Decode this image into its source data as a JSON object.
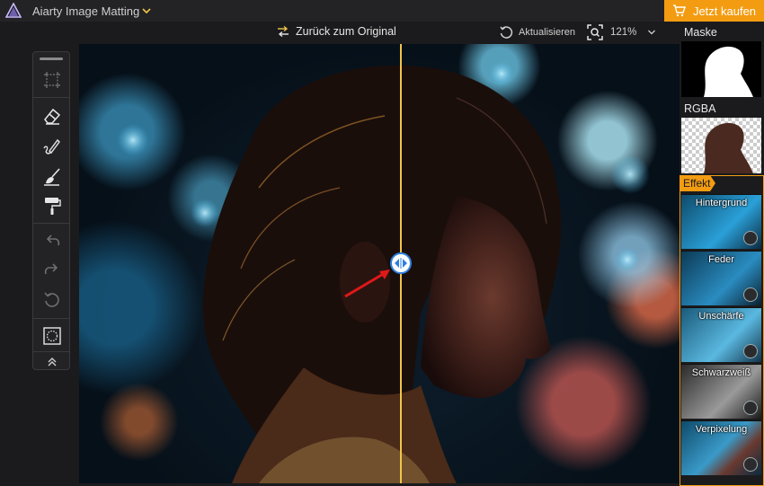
{
  "app": {
    "title": "Aiarty Image Matting",
    "buy_label": "Jetzt kaufen",
    "accent": "#f39c12"
  },
  "toolbar": {
    "back_label": "Zurück zum Original",
    "refresh_label": "Aktualisieren",
    "zoom_label": "121%"
  },
  "tools": [
    {
      "name": "select-region-icon"
    },
    {
      "name": "eraser-icon"
    },
    {
      "name": "brush-icon"
    },
    {
      "name": "broom-icon"
    },
    {
      "name": "paint-roller-icon"
    },
    {
      "name": "undo-icon"
    },
    {
      "name": "redo-icon"
    },
    {
      "name": "reset-icon"
    },
    {
      "name": "lasso-icon"
    },
    {
      "name": "collapse-icon"
    }
  ],
  "rightpanel": {
    "mask_label": "Maske",
    "rgba_label": "RGBA",
    "effect_label": "Effekt",
    "effects": [
      {
        "label": "Hintergrund"
      },
      {
        "label": "Feder"
      },
      {
        "label": "Unschärfe"
      },
      {
        "label": "Schwarzweiß"
      },
      {
        "label": "Verpixelung"
      }
    ]
  },
  "compare": {
    "split_position": 0.535
  }
}
